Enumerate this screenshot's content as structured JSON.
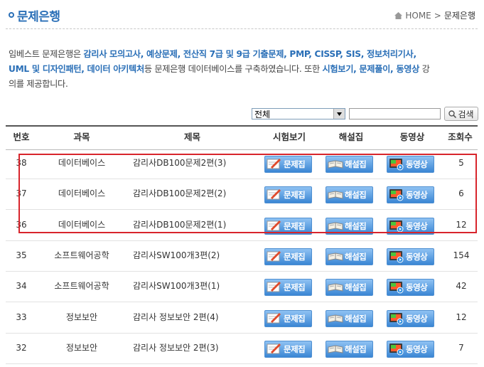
{
  "header": {
    "title": "문제은행",
    "breadcrumb": {
      "home": "HOME",
      "separator": ">",
      "current": "문제은행"
    }
  },
  "intro": {
    "line1_pre": "임베스트 문제은행은 ",
    "line1_hl": "감리사 모의고사, 예상문제, 전산직 7급 및 9급 기출문제, PMP, CISSP, SIS, 정보처리기사,",
    "line2_hl": "UML 및 디자인패턴, 데이터 아키텍처",
    "line2_mid": "등 문제은행 데이터베이스를 구축하였습니다. 또한 ",
    "line2_hl2": "시험보기, 문제풀이, 동영상",
    "line2_post": " 강",
    "line3": "의를 제공합니다."
  },
  "search": {
    "selected": "전체",
    "button_label": "검색"
  },
  "table": {
    "headers": [
      "번호",
      "과목",
      "제목",
      "시험보기",
      "해설집",
      "동영상",
      "조회수"
    ],
    "button_labels": {
      "exam": "문제집",
      "solution": "해설집",
      "video": "동영상"
    },
    "rows": [
      {
        "no": "38",
        "subject": "데이터베이스",
        "title": "감리사DB100문제2편(3)",
        "views": "5"
      },
      {
        "no": "37",
        "subject": "데이터베이스",
        "title": "감리사DB100문제2편(2)",
        "views": "6"
      },
      {
        "no": "36",
        "subject": "데이터베이스",
        "title": "감리사DB100문제2편(1)",
        "views": "12"
      },
      {
        "no": "35",
        "subject": "소프트웨어공학",
        "title": "감리사SW100개3편(2)",
        "views": "154"
      },
      {
        "no": "34",
        "subject": "소프트웨어공학",
        "title": "감리사SW100개3편(1)",
        "views": "42"
      },
      {
        "no": "33",
        "subject": "정보보안",
        "title": "감리사 정보보안 2편(4)",
        "views": "12"
      },
      {
        "no": "32",
        "subject": "정보보안",
        "title": "감리사 정보보안 2편(3)",
        "views": "7"
      }
    ]
  },
  "colors": {
    "accent": "#2a6fb7",
    "highlight_border": "#d8252c",
    "button": "#3a86d4"
  }
}
